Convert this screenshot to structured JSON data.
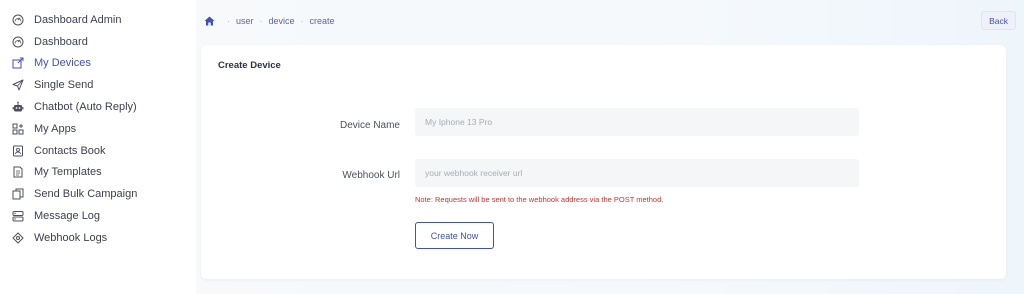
{
  "sidebar": {
    "items": [
      {
        "label": "Dashboard Admin",
        "icon": "dashboard-icon"
      },
      {
        "label": "Dashboard",
        "icon": "dashboard-icon"
      },
      {
        "label": "My Devices",
        "icon": "external-link-icon",
        "active": true
      },
      {
        "label": "Single Send",
        "icon": "send-icon"
      },
      {
        "label": "Chatbot (Auto Reply)",
        "icon": "robot-icon"
      },
      {
        "label": "My Apps",
        "icon": "apps-icon"
      },
      {
        "label": "Contacts Book",
        "icon": "contacts-book-icon"
      },
      {
        "label": "My Templates",
        "icon": "template-icon"
      },
      {
        "label": "Send Bulk Campaign",
        "icon": "copy-icon"
      },
      {
        "label": "Message Log",
        "icon": "message-log-icon"
      },
      {
        "label": "Webhook Logs",
        "icon": "webhook-icon"
      }
    ]
  },
  "breadcrumb": {
    "items": [
      "user",
      "device",
      "create"
    ],
    "separator": "·"
  },
  "header": {
    "back_label": "Back"
  },
  "card": {
    "title": "Create Device",
    "fields": {
      "device_name": {
        "label": "Device Name",
        "placeholder": "My Iphone 13 Pro",
        "value": ""
      },
      "webhook_url": {
        "label": "Webhook Url",
        "placeholder": "your webhook receiver url",
        "value": ""
      }
    },
    "note": "Note: Requests will be sent to the webhook address via the POST method.",
    "submit_label": "Create Now"
  },
  "colors": {
    "accent": "#3f51b5",
    "note": "#d03030"
  }
}
